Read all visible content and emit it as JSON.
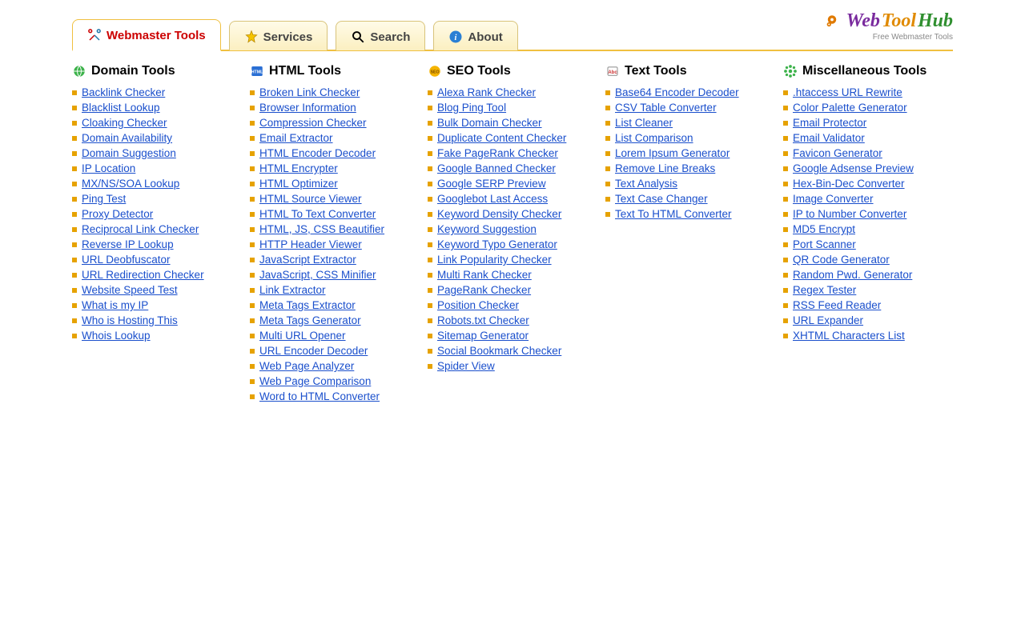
{
  "logo": {
    "part1": "Web",
    "part2": "Tool",
    "part3": "Hub",
    "tagline": "Free Webmaster Tools"
  },
  "tabs": {
    "webmaster": "Webmaster Tools",
    "services": "Services",
    "search": "Search",
    "about": "About"
  },
  "columns": [
    {
      "title": "Domain Tools",
      "icon": "globe",
      "items": [
        "Backlink Checker",
        "Blacklist Lookup",
        "Cloaking Checker",
        "Domain Availability",
        "Domain Suggestion",
        "IP Location",
        "MX/NS/SOA Lookup",
        "Ping Test",
        "Proxy Detector",
        "Reciprocal Link Checker",
        "Reverse IP Lookup",
        "URL Deobfuscator",
        "URL Redirection Checker",
        "Website Speed Test",
        "What is my IP",
        "Who is Hosting This",
        "Whois Lookup"
      ]
    },
    {
      "title": "HTML Tools",
      "icon": "html",
      "items": [
        "Broken Link Checker",
        "Browser Information",
        "Compression Checker",
        "Email Extractor",
        "HTML Encoder Decoder",
        "HTML Encrypter",
        "HTML Optimizer",
        "HTML Source Viewer",
        "HTML To Text Converter",
        "HTML, JS, CSS Beautifier",
        "HTTP Header Viewer",
        "JavaScript Extractor",
        "JavaScript, CSS Minifier",
        "Link Extractor",
        "Meta Tags Extractor",
        "Meta Tags Generator",
        "Multi URL Opener",
        "URL Encoder Decoder",
        "Web Page Analyzer",
        "Web Page Comparison",
        "Word to HTML Converter"
      ]
    },
    {
      "title": "SEO Tools",
      "icon": "seo",
      "items": [
        "Alexa Rank Checker",
        "Blog Ping Tool",
        "Bulk Domain Checker",
        "Duplicate Content Checker",
        "Fake PageRank Checker",
        "Google Banned Checker",
        "Google SERP Preview",
        "Googlebot Last Access",
        "Keyword Density Checker",
        "Keyword Suggestion",
        "Keyword Typo Generator",
        "Link Popularity Checker",
        "Multi Rank Checker",
        "PageRank Checker",
        "Position Checker",
        "Robots.txt Checker",
        "Sitemap Generator",
        "Social Bookmark Checker",
        "Spider View"
      ]
    },
    {
      "title": "Text Tools",
      "icon": "text",
      "items": [
        "Base64 Encoder Decoder",
        "CSV Table Converter",
        "List Cleaner",
        "List Comparison",
        "Lorem Ipsum Generator",
        "Remove Line Breaks",
        "Text Analysis",
        "Text Case Changer",
        "Text To HTML Converter"
      ]
    },
    {
      "title": "Miscellaneous Tools",
      "icon": "misc",
      "items": [
        ".htaccess URL Rewrite",
        "Color Palette Generator",
        "Email Protector",
        "Email Validator",
        "Favicon Generator",
        "Google Adsense Preview",
        "Hex-Bin-Dec Converter",
        "Image Converter",
        "IP to Number Converter",
        "MD5 Encrypt",
        "Port Scanner",
        "QR Code Generator",
        "Random Pwd. Generator",
        "Regex Tester",
        "RSS Feed Reader",
        "URL Expander",
        "XHTML Characters List"
      ]
    }
  ]
}
